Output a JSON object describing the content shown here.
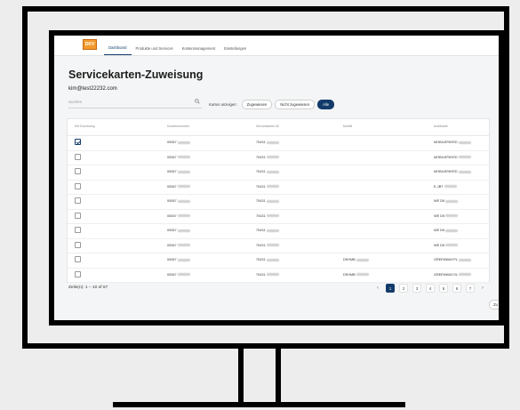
{
  "nav": {
    "logo_text": "DKV",
    "tabs": [
      "Dashboard",
      "Produkte und Services",
      "Kostenmanagement",
      "Einstellungen"
    ],
    "active_tab": 0
  },
  "page": {
    "title": "Servicekarten-Zuweisung",
    "email": "kim@test22232.com"
  },
  "search": {
    "placeholder": "Suchen"
  },
  "filter": {
    "label": "Karten anzeigen:",
    "options": [
      "Zugewiesen",
      "Nicht zugewiesen",
      "Alle"
    ],
    "selected": "Alle"
  },
  "table": {
    "columns": [
      "Mit Zuordnung",
      "Kundennummer",
      "Servicekarten-ID",
      "Mobilit",
      "Auditkarte"
    ],
    "rows": [
      {
        "checked": true,
        "customer": "00067",
        "card": "70431",
        "mobil": "",
        "provider": "MOBILEPAYED"
      },
      {
        "checked": false,
        "customer": "00067",
        "card": "70431",
        "mobil": "",
        "provider": "MOBILEPAYED"
      },
      {
        "checked": false,
        "customer": "00067",
        "card": "70431",
        "mobil": "",
        "provider": "MOBILEPAYED"
      },
      {
        "checked": false,
        "customer": "00067",
        "card": "70431",
        "mobil": "",
        "provider": "E-JBT"
      },
      {
        "checked": false,
        "customer": "00067",
        "card": "70431",
        "mobil": "",
        "provider": "WE DK"
      },
      {
        "checked": false,
        "customer": "00067",
        "card": "70431",
        "mobil": "",
        "provider": "WE DK"
      },
      {
        "checked": false,
        "customer": "00067",
        "card": "70431",
        "mobil": "",
        "provider": "WE DK"
      },
      {
        "checked": false,
        "customer": "00067",
        "card": "70431",
        "mobil": "",
        "provider": "WE DK"
      },
      {
        "checked": false,
        "customer": "00067",
        "card": "70431",
        "mobil": "DEHMB",
        "provider": "GREENWAY.PL"
      },
      {
        "checked": false,
        "customer": "00067",
        "card": "70431",
        "mobil": "DEHMB",
        "provider": "GREENWAY.SL"
      }
    ]
  },
  "footer": {
    "rows_info": "Zeile(n): 1 – 10 of 67",
    "pages": [
      "1",
      "2",
      "3",
      "4",
      "5",
      "6",
      "7"
    ],
    "active_page": "1",
    "prev": "‹",
    "next": "›"
  },
  "corner_chip": "Zu",
  "colors": {
    "primary": "#123b6b",
    "logo": "#f39a2c"
  }
}
